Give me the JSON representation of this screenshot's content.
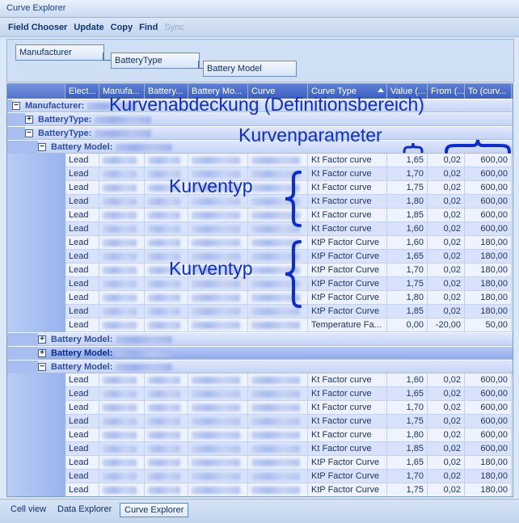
{
  "window": {
    "title": "Curve Explorer"
  },
  "toolbar": [
    {
      "label": "Field Chooser",
      "enabled": true
    },
    {
      "label": "Update",
      "enabled": true
    },
    {
      "label": "Copy",
      "enabled": true
    },
    {
      "label": "Find",
      "enabled": true
    },
    {
      "label": "Sync",
      "enabled": false
    }
  ],
  "grouping": [
    "Manufacturer",
    "BatteryType",
    "Battery Model"
  ],
  "columns": [
    "Elect...",
    "Manufa...",
    "Battery...",
    "Battery Mo...",
    "Curve",
    "Curve Type",
    "Value (...",
    "From (...",
    "To (curv..."
  ],
  "sorted_column": "Curve Type",
  "groups": {
    "manufacturer": "Manufacturer:",
    "battery_type": "BatteryType:",
    "battery_model": "Battery Model:"
  },
  "rows": [
    {
      "kind": "group",
      "level": 0,
      "label": "Manufacturer:",
      "expanded": true
    },
    {
      "kind": "group",
      "level": 1,
      "label": "BatteryType:",
      "expanded": false
    },
    {
      "kind": "group",
      "level": 1,
      "label": "BatteryType:",
      "expanded": true
    },
    {
      "kind": "group",
      "level": 2,
      "label": "Battery Model:",
      "expanded": true
    },
    {
      "kind": "data",
      "elect": "Lead",
      "type": "Kt Factor curve",
      "value": "1,65",
      "from": "0,02",
      "to": "600,00"
    },
    {
      "kind": "data",
      "elect": "Lead",
      "type": "Kt Factor curve",
      "value": "1,70",
      "from": "0,02",
      "to": "600,00"
    },
    {
      "kind": "data",
      "elect": "Lead",
      "type": "Kt Factor curve",
      "value": "1,75",
      "from": "0,02",
      "to": "600,00"
    },
    {
      "kind": "data",
      "elect": "Lead",
      "type": "Kt Factor curve",
      "value": "1,80",
      "from": "0,02",
      "to": "600,00"
    },
    {
      "kind": "data",
      "elect": "Lead",
      "type": "Kt Factor curve",
      "value": "1,85",
      "from": "0,02",
      "to": "600,00"
    },
    {
      "kind": "data",
      "elect": "Lead",
      "type": "Kt Factor curve",
      "value": "1,60",
      "from": "0,02",
      "to": "600,00"
    },
    {
      "kind": "data",
      "elect": "Lead",
      "type": "KtP Factor Curve",
      "value": "1,60",
      "from": "0,02",
      "to": "180,00"
    },
    {
      "kind": "data",
      "elect": "Lead",
      "type": "KtP Factor Curve",
      "value": "1,65",
      "from": "0,02",
      "to": "180,00"
    },
    {
      "kind": "data",
      "elect": "Lead",
      "type": "KtP Factor Curve",
      "value": "1,70",
      "from": "0,02",
      "to": "180,00"
    },
    {
      "kind": "data",
      "elect": "Lead",
      "type": "KtP Factor Curve",
      "value": "1,75",
      "from": "0,02",
      "to": "180,00"
    },
    {
      "kind": "data",
      "elect": "Lead",
      "type": "KtP Factor Curve",
      "value": "1,80",
      "from": "0,02",
      "to": "180,00"
    },
    {
      "kind": "data",
      "elect": "Lead",
      "type": "KtP Factor Curve",
      "value": "1,85",
      "from": "0,02",
      "to": "180,00"
    },
    {
      "kind": "data",
      "elect": "Lead",
      "type": "Temperature Fa...",
      "value": "0,00",
      "from": "-20,00",
      "to": "50,00"
    },
    {
      "kind": "group",
      "level": 2,
      "label": "Battery Model:",
      "expanded": false
    },
    {
      "kind": "group",
      "level": 2,
      "label": "Battery Model:",
      "expanded": false,
      "selected": true
    },
    {
      "kind": "group",
      "level": 2,
      "label": "Battery Model:",
      "expanded": true
    },
    {
      "kind": "data",
      "elect": "Lead",
      "type": "Kt Factor curve",
      "value": "1,60",
      "from": "0,02",
      "to": "600,00"
    },
    {
      "kind": "data",
      "elect": "Lead",
      "type": "Kt Factor curve",
      "value": "1,65",
      "from": "0,02",
      "to": "600,00"
    },
    {
      "kind": "data",
      "elect": "Lead",
      "type": "Kt Factor curve",
      "value": "1,70",
      "from": "0,02",
      "to": "600,00"
    },
    {
      "kind": "data",
      "elect": "Lead",
      "type": "Kt Factor curve",
      "value": "1,75",
      "from": "0,02",
      "to": "600,00"
    },
    {
      "kind": "data",
      "elect": "Lead",
      "type": "Kt Factor curve",
      "value": "1,80",
      "from": "0,02",
      "to": "600,00"
    },
    {
      "kind": "data",
      "elect": "Lead",
      "type": "Kt Factor curve",
      "value": "1,85",
      "from": "0,02",
      "to": "600,00"
    },
    {
      "kind": "data",
      "elect": "Lead",
      "type": "KtP Factor Curve",
      "value": "1,65",
      "from": "0,02",
      "to": "180,00"
    },
    {
      "kind": "data",
      "elect": "Lead",
      "type": "KtP Factor Curve",
      "value": "1,70",
      "from": "0,02",
      "to": "180,00"
    },
    {
      "kind": "data",
      "elect": "Lead",
      "type": "KtP Factor Curve",
      "value": "1,75",
      "from": "0,02",
      "to": "180,00"
    }
  ],
  "annotations": {
    "coverage": "Kurvenabdeckung (Definitionsbereich)",
    "parameters": "Kurvenparameter",
    "curve_type_1": "Kurventyp",
    "curve_type_2": "Kurventyp"
  },
  "annotation_color": "#0b2bd6",
  "bottom_tabs": [
    {
      "label": "Cell view",
      "active": false
    },
    {
      "label": "Data Explorer",
      "active": false
    },
    {
      "label": "Curve Explorer",
      "active": true
    }
  ]
}
